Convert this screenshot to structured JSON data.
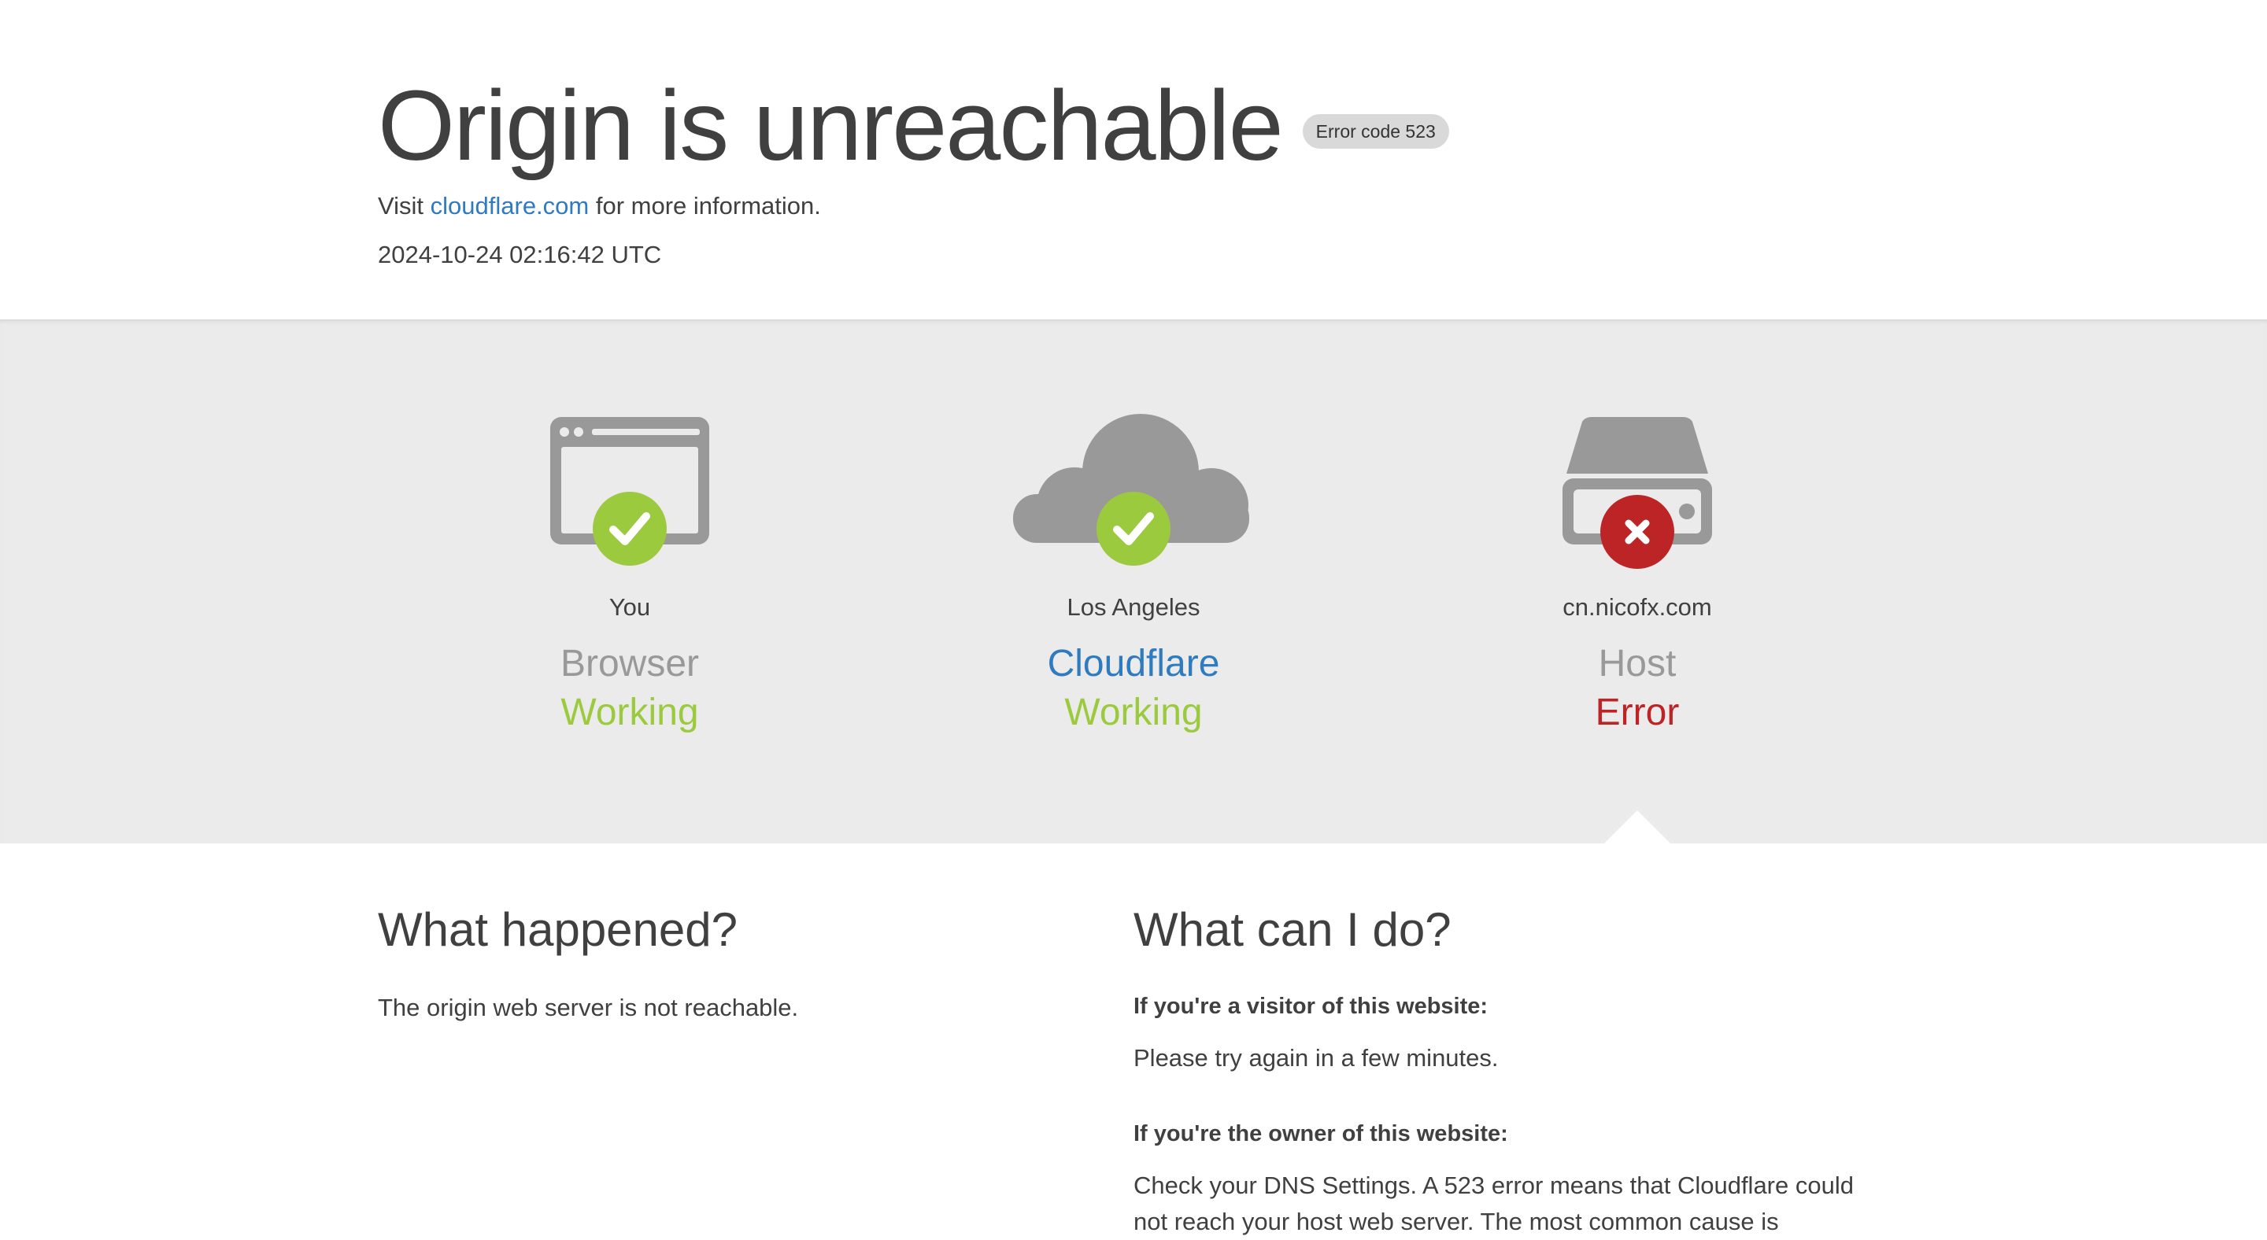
{
  "header": {
    "title": "Origin is unreachable",
    "error_badge": "Error code 523",
    "visit_prefix": "Visit",
    "visit_link": "cloudflare.com",
    "visit_suffix": "for more information.",
    "timestamp": "2024-10-24 02:16:42 UTC"
  },
  "nodes": [
    {
      "location": "You",
      "name": "Browser",
      "state": "Working",
      "icon": "browser-window-icon",
      "status_icon": "check-icon"
    },
    {
      "location": "Los Angeles",
      "name": "Cloudflare",
      "state": "Working",
      "icon": "cloud-icon",
      "status_icon": "check-icon"
    },
    {
      "location": "cn.nicofx.com",
      "name": "Host",
      "state": "Error",
      "icon": "server-icon",
      "status_icon": "x-icon"
    }
  ],
  "what_happened": {
    "heading": "What happened?",
    "text": "The origin web server is not reachable."
  },
  "what_can_i_do": {
    "heading": "What can I do?",
    "visitor_label": "If you're a visitor of this website:",
    "visitor_text": "Please try again in a few minutes.",
    "owner_label": "If you're the owner of this website:",
    "owner_text": "Check your DNS Settings. A 523 error means that Cloudflare could not reach your host web server. The most common cause is"
  },
  "colors": {
    "ok": "#9bca3e",
    "error": "#bd2426",
    "link": "#2f7bbf",
    "icon_gray": "#999999",
    "band": "#ebebeb"
  }
}
